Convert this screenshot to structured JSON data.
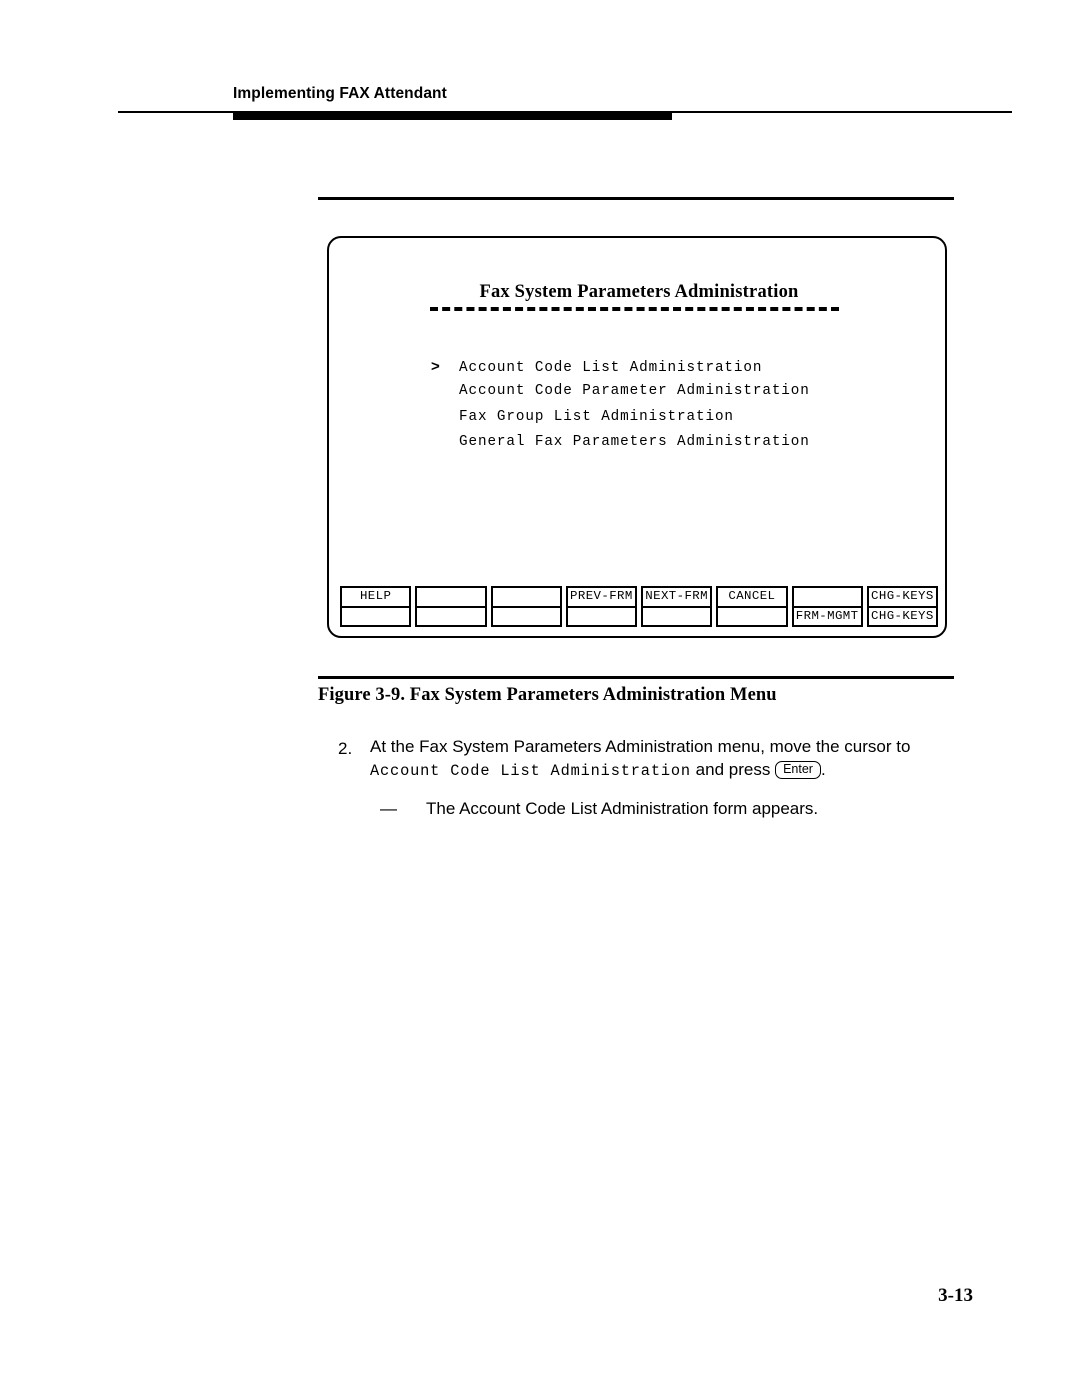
{
  "page": {
    "running_header": "Implementing FAX Attendant",
    "page_number": "3-13"
  },
  "figure": {
    "caption": "Figure 3-9.  Fax System Parameters Administration Menu",
    "screen": {
      "title": "Fax System Parameters Administration",
      "cursor_glyph": ">",
      "menu_items": [
        {
          "cursor": ">",
          "label": "Account Code List Administration"
        },
        {
          "cursor": "",
          "label": "Account Code Parameter Administration"
        },
        {
          "cursor": "",
          "label": "Fax Group List Administration"
        },
        {
          "cursor": "",
          "label": "General Fax Parameters Administration"
        }
      ],
      "function_keys": [
        {
          "top": "HELP",
          "bottom": ""
        },
        {
          "top": "",
          "bottom": ""
        },
        {
          "top": "",
          "bottom": ""
        },
        {
          "top": "PREV-FRM",
          "bottom": ""
        },
        {
          "top": "NEXT-FRM",
          "bottom": ""
        },
        {
          "top": "CANCEL",
          "bottom": ""
        },
        {
          "top": "",
          "bottom": "FRM-MGMT"
        },
        {
          "top": "CHG-KEYS",
          "bottom": "CHG-KEYS"
        }
      ]
    }
  },
  "steps": [
    {
      "number": "2.",
      "text_before": "At the Fax System Parameters Administration menu, move the cursor to",
      "mono_text": "Account Code List Administration",
      "text_after": " and press ",
      "key_cap": "Enter",
      "text_end": ".",
      "sub_bullets": [
        {
          "dash": "—",
          "text": "The Account Code List Administration form appears."
        }
      ]
    }
  ]
}
